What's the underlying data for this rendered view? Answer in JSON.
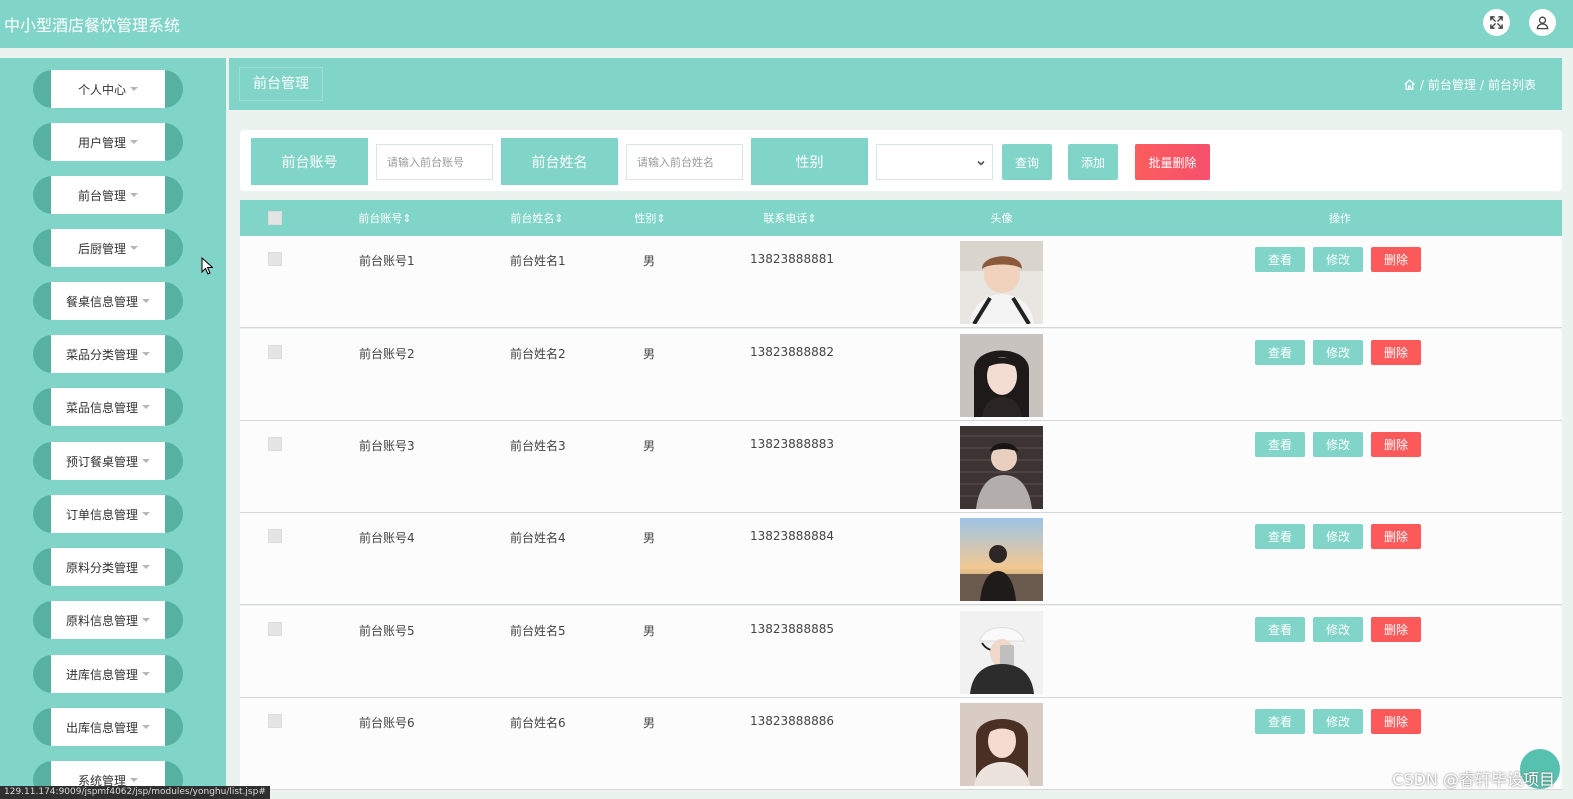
{
  "app": {
    "title": "中小型酒店餐饮管理系统"
  },
  "topbar": {
    "icons": [
      "fullscreen-icon",
      "user-icon"
    ]
  },
  "sidebar": {
    "items": [
      {
        "label": "个人中心"
      },
      {
        "label": "用户管理"
      },
      {
        "label": "前台管理"
      },
      {
        "label": "后厨管理"
      },
      {
        "label": "餐桌信息管理"
      },
      {
        "label": "菜品分类管理"
      },
      {
        "label": "菜品信息管理"
      },
      {
        "label": "预订餐桌管理"
      },
      {
        "label": "订单信息管理"
      },
      {
        "label": "原料分类管理"
      },
      {
        "label": "原料信息管理"
      },
      {
        "label": "进库信息管理"
      },
      {
        "label": "出库信息管理"
      },
      {
        "label": "系统管理"
      }
    ]
  },
  "header": {
    "tab": "前台管理",
    "breadcrumb": {
      "home_icon": "home-icon",
      "sep": "/",
      "level1": "前台管理",
      "level2": "前台列表"
    }
  },
  "search": {
    "account_label": "前台账号",
    "account_placeholder": "请输入前台账号",
    "name_label": "前台姓名",
    "name_placeholder": "请输入前台姓名",
    "gender_label": "性别",
    "gender_value": "",
    "query_button": "查询",
    "add_button": "添加",
    "batch_delete_button": "批量删除"
  },
  "table": {
    "columns": [
      "前台账号",
      "前台姓名",
      "性别",
      "联系电话",
      "头像",
      "操作"
    ],
    "sort_icon": "sort-icon",
    "actions": {
      "view": "查看",
      "edit": "修改",
      "delete": "删除"
    },
    "rows": [
      {
        "account": "前台账号1",
        "name": "前台姓名1",
        "gender": "男",
        "phone": "13823888881"
      },
      {
        "account": "前台账号2",
        "name": "前台姓名2",
        "gender": "男",
        "phone": "13823888882"
      },
      {
        "account": "前台账号3",
        "name": "前台姓名3",
        "gender": "男",
        "phone": "13823888883"
      },
      {
        "account": "前台账号4",
        "name": "前台姓名4",
        "gender": "男",
        "phone": "13823888884"
      },
      {
        "account": "前台账号5",
        "name": "前台姓名5",
        "gender": "男",
        "phone": "13823888885"
      },
      {
        "account": "前台账号6",
        "name": "前台姓名6",
        "gender": "男",
        "phone": "13823888886"
      }
    ]
  },
  "statusbar": {
    "url": "129.11.174:9009/jspmf4062/jsp/modules/yonghu/list.jsp#"
  },
  "watermark": "CSDN @睿轩毕设项目",
  "colors": {
    "accent": "#80d4c8",
    "danger": "#fc5a5a",
    "sidebar_edge": "#56b1a0"
  }
}
